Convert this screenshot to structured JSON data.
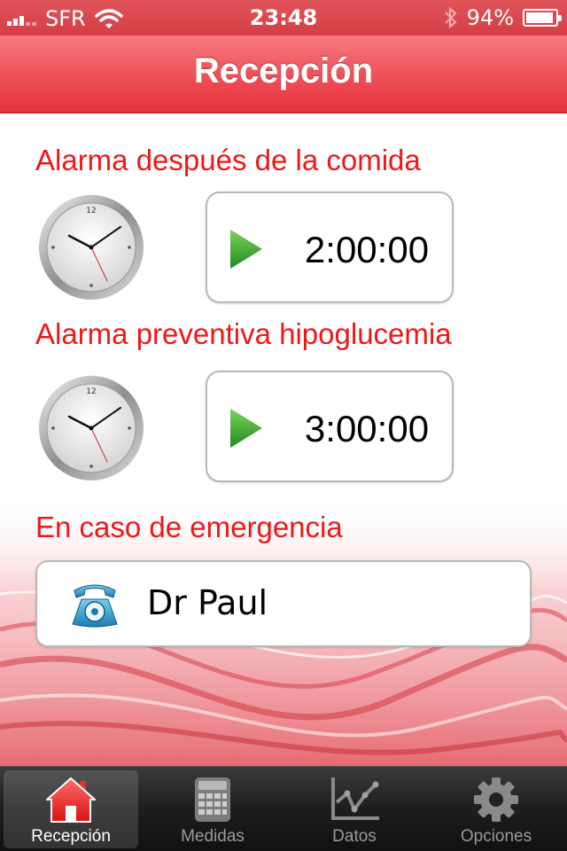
{
  "status_bar": {
    "carrier": "SFR",
    "time": "23:48",
    "battery": "94%",
    "battery_level": 0.94,
    "icons": [
      "signal-icon",
      "wifi-icon",
      "bluetooth-icon",
      "battery-icon"
    ]
  },
  "header": {
    "title": "Recepción"
  },
  "alarms": [
    {
      "label": "Alarma después de la comida",
      "time": "2:00:00"
    },
    {
      "label": "Alarma preventiva hipoglucemia",
      "time": "3:00:00"
    }
  ],
  "emergency": {
    "label": "En caso de emergencia",
    "contact_name": "Dr Paul"
  },
  "tabs": [
    {
      "label": "Recepción",
      "icon": "home-icon",
      "active": true
    },
    {
      "label": "Medidas",
      "icon": "calculator-icon",
      "active": false
    },
    {
      "label": "Datos",
      "icon": "chart-icon",
      "active": false
    },
    {
      "label": "Opciones",
      "icon": "gear-icon",
      "active": false
    }
  ],
  "colors": {
    "accent": "#ee1818",
    "header": "#ee4f57",
    "tab_bar": "#1e1e1e"
  }
}
